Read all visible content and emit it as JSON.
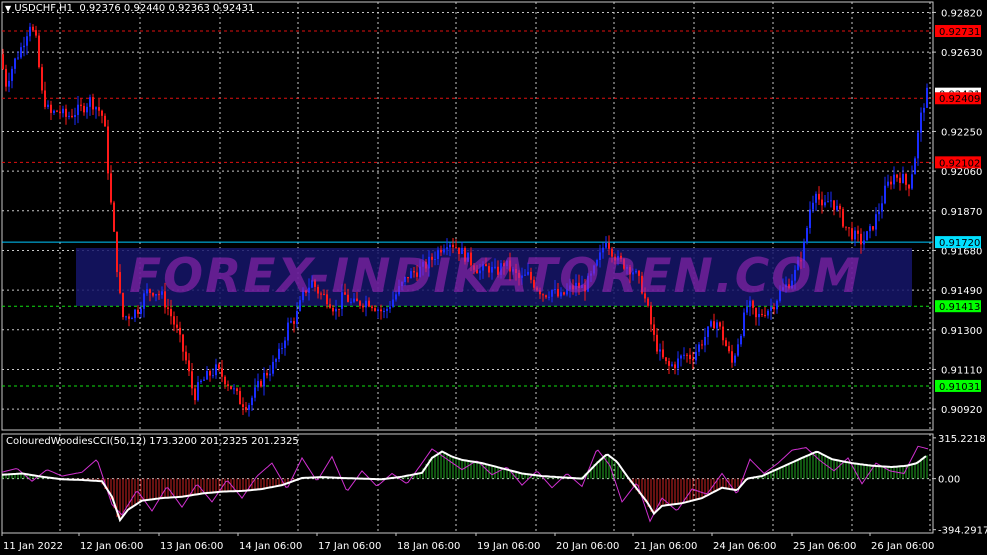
{
  "symbol_header": {
    "symbol": "USDCHF,H1",
    "ohlc": "0.92376 0.92440 0.92363 0.92431"
  },
  "indicator_header": {
    "name": "ColouredWoodiesCCI(50,12)",
    "values": "173.3200 201.2325 201.2325"
  },
  "watermark": "FOREX-INDIKATOREN.COM",
  "colors": {
    "bull_candle": "#1a2dff",
    "bear_candle": "#ff1a1a",
    "grid": "#c8c8c8",
    "cci_line": "#ffffff",
    "cci_fast": "#d030d0",
    "hist_pos": "#22aa22",
    "hist_neg": "#cc2222",
    "band": "#15156a"
  },
  "chart_data": [
    {
      "type": "candlestick",
      "symbol": "USDCHF",
      "timeframe": "H1",
      "ylim": [
        0.9082,
        0.9287
      ],
      "price_axis_ticks": [
        "0.92820",
        "0.92630",
        "0.92250",
        "0.92060",
        "0.91870",
        "0.91680",
        "0.91490",
        "0.91300",
        "0.91110",
        "0.90920"
      ],
      "time_labels": [
        "11 Jan 2022",
        "12 Jan 06:00",
        "13 Jan 06:00",
        "14 Jan 06:00",
        "17 Jan 06:00",
        "18 Jan 06:00",
        "19 Jan 06:00",
        "20 Jan 06:00",
        "21 Jan 06:00",
        "24 Jan 06:00",
        "25 Jan 06:00",
        "26 Jan 06:00"
      ],
      "levels": [
        {
          "label": "0.92731",
          "value": 0.92731,
          "color": "#e01010",
          "style": "dash"
        },
        {
          "label": "0.92409",
          "value": 0.92409,
          "color": "#e01010",
          "style": "dash"
        },
        {
          "label": "0.92102",
          "value": 0.92102,
          "color": "#e01010",
          "style": "dash"
        },
        {
          "label": "0.91720",
          "value": 0.9172,
          "color": "#00c8ff",
          "style": "solid"
        },
        {
          "label": "0.91413",
          "value": 0.91413,
          "color": "#10e010",
          "style": "dash"
        },
        {
          "label": "0.91031",
          "value": 0.91031,
          "color": "#10e010",
          "style": "dash"
        }
      ],
      "current_price": {
        "label": "0.92431",
        "value": 0.92431
      },
      "close_path": [
        [
          0,
          0.9262
        ],
        [
          6,
          0.9248
        ],
        [
          14,
          0.9258
        ],
        [
          22,
          0.9266
        ],
        [
          30,
          0.9277
        ],
        [
          36,
          0.9268
        ],
        [
          42,
          0.9243
        ],
        [
          50,
          0.9233
        ],
        [
          58,
          0.9235
        ],
        [
          66,
          0.9232
        ],
        [
          74,
          0.9234
        ],
        [
          82,
          0.9236
        ],
        [
          90,
          0.924
        ],
        [
          98,
          0.9236
        ],
        [
          104,
          0.9231
        ],
        [
          110,
          0.9195
        ],
        [
          116,
          0.9165
        ],
        [
          122,
          0.9136
        ],
        [
          130,
          0.9137
        ],
        [
          138,
          0.914
        ],
        [
          146,
          0.9148
        ],
        [
          154,
          0.9149
        ],
        [
          162,
          0.9146
        ],
        [
          170,
          0.9138
        ],
        [
          178,
          0.9128
        ],
        [
          186,
          0.9115
        ],
        [
          194,
          0.9098
        ],
        [
          200,
          0.9104
        ],
        [
          208,
          0.9108
        ],
        [
          216,
          0.9111
        ],
        [
          224,
          0.9107
        ],
        [
          232,
          0.9102
        ],
        [
          240,
          0.9096
        ],
        [
          248,
          0.9094
        ],
        [
          256,
          0.9101
        ],
        [
          264,
          0.9108
        ],
        [
          272,
          0.9112
        ],
        [
          280,
          0.9119
        ],
        [
          288,
          0.9132
        ],
        [
          296,
          0.9136
        ],
        [
          304,
          0.9148
        ],
        [
          312,
          0.9153
        ],
        [
          320,
          0.9147
        ],
        [
          328,
          0.9145
        ],
        [
          336,
          0.9139
        ],
        [
          344,
          0.9147
        ],
        [
          352,
          0.9142
        ],
        [
          360,
          0.9143
        ],
        [
          368,
          0.9144
        ],
        [
          376,
          0.9141
        ],
        [
          384,
          0.9138
        ],
        [
          392,
          0.9144
        ],
        [
          400,
          0.915
        ],
        [
          408,
          0.9156
        ],
        [
          416,
          0.9158
        ],
        [
          424,
          0.916
        ],
        [
          432,
          0.9164
        ],
        [
          440,
          0.9169
        ],
        [
          448,
          0.9173
        ],
        [
          456,
          0.917
        ],
        [
          464,
          0.9166
        ],
        [
          472,
          0.9162
        ],
        [
          480,
          0.9158
        ],
        [
          488,
          0.916
        ],
        [
          496,
          0.9157
        ],
        [
          504,
          0.9162
        ],
        [
          512,
          0.9158
        ],
        [
          520,
          0.9154
        ],
        [
          528,
          0.9156
        ],
        [
          536,
          0.9151
        ],
        [
          544,
          0.9147
        ],
        [
          552,
          0.9149
        ],
        [
          560,
          0.9145
        ],
        [
          568,
          0.9149
        ],
        [
          576,
          0.9151
        ],
        [
          584,
          0.915
        ],
        [
          592,
          0.9156
        ],
        [
          600,
          0.9165
        ],
        [
          606,
          0.9174
        ],
        [
          612,
          0.9168
        ],
        [
          618,
          0.9163
        ],
        [
          626,
          0.9161
        ],
        [
          634,
          0.9158
        ],
        [
          642,
          0.915
        ],
        [
          648,
          0.9139
        ],
        [
          654,
          0.9126
        ],
        [
          660,
          0.9118
        ],
        [
          668,
          0.9112
        ],
        [
          676,
          0.9114
        ],
        [
          684,
          0.9118
        ],
        [
          692,
          0.9117
        ],
        [
          700,
          0.9123
        ],
        [
          708,
          0.9129
        ],
        [
          716,
          0.9135
        ],
        [
          724,
          0.9125
        ],
        [
          732,
          0.9114
        ],
        [
          740,
          0.9128
        ],
        [
          748,
          0.9143
        ],
        [
          756,
          0.9135
        ],
        [
          764,
          0.9139
        ],
        [
          772,
          0.9141
        ],
        [
          780,
          0.9148
        ],
        [
          788,
          0.9152
        ],
        [
          796,
          0.9158
        ],
        [
          804,
          0.917
        ],
        [
          810,
          0.9188
        ],
        [
          816,
          0.9198
        ],
        [
          822,
          0.9187
        ],
        [
          830,
          0.9193
        ],
        [
          838,
          0.9187
        ],
        [
          846,
          0.9179
        ],
        [
          854,
          0.9175
        ],
        [
          862,
          0.9172
        ],
        [
          870,
          0.9177
        ],
        [
          878,
          0.9186
        ],
        [
          886,
          0.9198
        ],
        [
          894,
          0.9204
        ],
        [
          902,
          0.9203
        ],
        [
          908,
          0.9198
        ],
        [
          914,
          0.921
        ],
        [
          920,
          0.923
        ],
        [
          926,
          0.9243
        ]
      ]
    },
    {
      "type": "line",
      "name": "ColouredWoodiesCCI(50,12)",
      "ylim": [
        -420,
        345
      ],
      "axis_ticks": [
        "315.2218",
        "0.00",
        "-394.2917"
      ],
      "cci_path": [
        [
          0,
          30
        ],
        [
          20,
          40
        ],
        [
          40,
          15
        ],
        [
          60,
          -5
        ],
        [
          80,
          -10
        ],
        [
          100,
          -20
        ],
        [
          110,
          -140
        ],
        [
          118,
          -320
        ],
        [
          126,
          -240
        ],
        [
          140,
          -170
        ],
        [
          160,
          -150
        ],
        [
          180,
          -140
        ],
        [
          200,
          -115
        ],
        [
          220,
          -100
        ],
        [
          240,
          -95
        ],
        [
          260,
          -80
        ],
        [
          280,
          -50
        ],
        [
          300,
          5
        ],
        [
          320,
          12
        ],
        [
          340,
          5
        ],
        [
          360,
          0
        ],
        [
          380,
          -5
        ],
        [
          400,
          15
        ],
        [
          420,
          45
        ],
        [
          430,
          160
        ],
        [
          440,
          210
        ],
        [
          450,
          170
        ],
        [
          460,
          145
        ],
        [
          480,
          120
        ],
        [
          500,
          80
        ],
        [
          520,
          40
        ],
        [
          540,
          20
        ],
        [
          560,
          10
        ],
        [
          580,
          0
        ],
        [
          595,
          120
        ],
        [
          605,
          190
        ],
        [
          615,
          130
        ],
        [
          625,
          20
        ],
        [
          635,
          -80
        ],
        [
          645,
          -180
        ],
        [
          652,
          -270
        ],
        [
          660,
          -210
        ],
        [
          680,
          -190
        ],
        [
          700,
          -150
        ],
        [
          720,
          -70
        ],
        [
          735,
          -90
        ],
        [
          745,
          0
        ],
        [
          760,
          20
        ],
        [
          780,
          90
        ],
        [
          800,
          160
        ],
        [
          815,
          210
        ],
        [
          830,
          150
        ],
        [
          850,
          120
        ],
        [
          870,
          100
        ],
        [
          890,
          90
        ],
        [
          905,
          100
        ],
        [
          915,
          120
        ],
        [
          925,
          180
        ]
      ],
      "fast_path": [
        [
          0,
          50
        ],
        [
          15,
          80
        ],
        [
          30,
          -20
        ],
        [
          45,
          70
        ],
        [
          60,
          20
        ],
        [
          80,
          50
        ],
        [
          95,
          150
        ],
        [
          110,
          -200
        ],
        [
          120,
          -280
        ],
        [
          135,
          -90
        ],
        [
          150,
          -250
        ],
        [
          165,
          -60
        ],
        [
          180,
          -220
        ],
        [
          195,
          -40
        ],
        [
          210,
          -180
        ],
        [
          225,
          -10
        ],
        [
          240,
          -150
        ],
        [
          255,
          20
        ],
        [
          270,
          120
        ],
        [
          285,
          -80
        ],
        [
          300,
          160
        ],
        [
          315,
          -20
        ],
        [
          330,
          170
        ],
        [
          345,
          -100
        ],
        [
          360,
          60
        ],
        [
          375,
          -60
        ],
        [
          390,
          40
        ],
        [
          405,
          -40
        ],
        [
          420,
          120
        ],
        [
          430,
          230
        ],
        [
          445,
          150
        ],
        [
          460,
          70
        ],
        [
          475,
          140
        ],
        [
          490,
          30
        ],
        [
          505,
          90
        ],
        [
          520,
          -50
        ],
        [
          535,
          60
        ],
        [
          550,
          -70
        ],
        [
          565,
          40
        ],
        [
          580,
          -60
        ],
        [
          595,
          230
        ],
        [
          608,
          100
        ],
        [
          620,
          -180
        ],
        [
          635,
          -30
        ],
        [
          648,
          -330
        ],
        [
          660,
          -150
        ],
        [
          675,
          -250
        ],
        [
          690,
          -80
        ],
        [
          705,
          -120
        ],
        [
          720,
          40
        ],
        [
          735,
          -120
        ],
        [
          748,
          150
        ],
        [
          762,
          40
        ],
        [
          776,
          120
        ],
        [
          790,
          220
        ],
        [
          804,
          240
        ],
        [
          818,
          140
        ],
        [
          832,
          60
        ],
        [
          846,
          160
        ],
        [
          860,
          -40
        ],
        [
          874,
          120
        ],
        [
          888,
          60
        ],
        [
          902,
          40
        ],
        [
          916,
          250
        ],
        [
          926,
          230
        ]
      ]
    }
  ]
}
